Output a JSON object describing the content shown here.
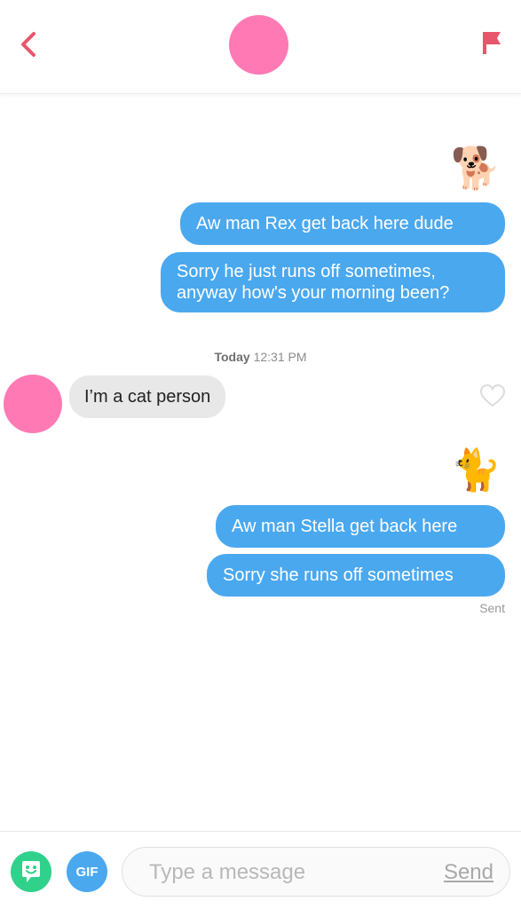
{
  "header": {
    "back_icon": "chevron-left-icon",
    "flag_icon": "flag-icon",
    "accent_color": "#e8566c",
    "avatar_color": "#ff7ab5"
  },
  "messages": [
    {
      "sender": "me",
      "type": "emoji",
      "emoji": "🐕"
    },
    {
      "sender": "me",
      "type": "text",
      "text": "Aw man Rex get back here dude"
    },
    {
      "sender": "me",
      "type": "text",
      "text": "Sorry he just runs off sometimes,",
      "text2": "anyway how's your morning been?"
    },
    {
      "sender": "match",
      "type": "text",
      "text": "I’m a cat person"
    },
    {
      "sender": "me",
      "type": "emoji",
      "emoji": "🐈"
    },
    {
      "sender": "me",
      "type": "text",
      "text": "Aw man Stella get back here"
    },
    {
      "sender": "me",
      "type": "text",
      "text": "Sorry she runs off sometimes"
    }
  ],
  "timestamp": {
    "day": "Today",
    "time": "12:31 PM"
  },
  "status": {
    "sent": "Sent"
  },
  "input_bar": {
    "sticker_icon": "sticker-face-icon",
    "gif_label": "GIF",
    "placeholder": "Type a message",
    "send_label": "Send"
  },
  "colors": {
    "outgoing_bubble": "#4aa8ef",
    "incoming_bubble": "#e8e8e8",
    "sticker_button": "#2fd18b",
    "gif_button": "#4aa8ef"
  }
}
